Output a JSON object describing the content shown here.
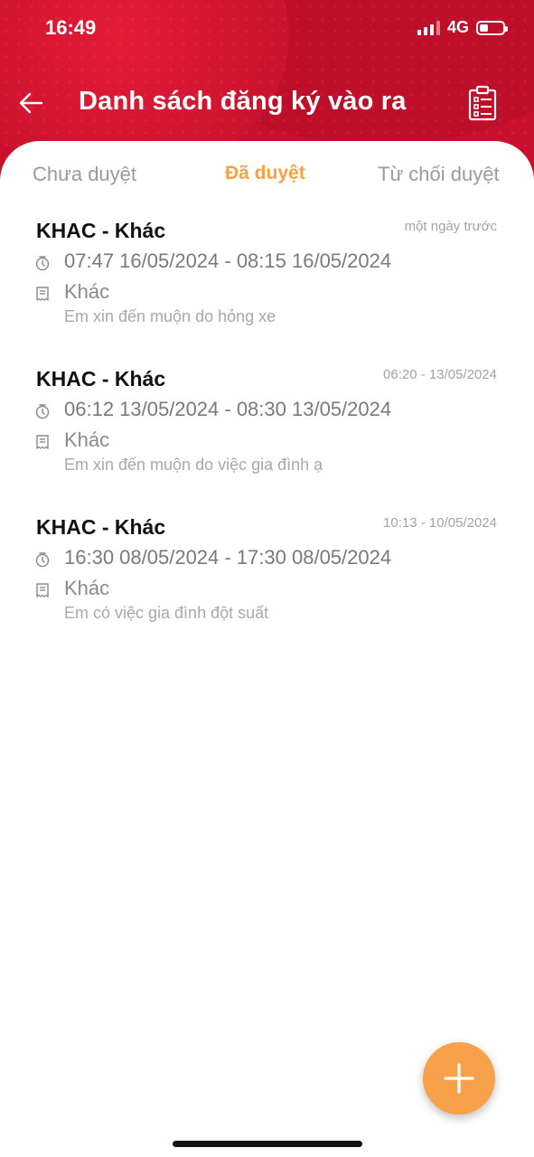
{
  "status_bar": {
    "time": "16:49",
    "network": "4G"
  },
  "header": {
    "title": "Danh sách đăng ký vào ra"
  },
  "tabs": [
    {
      "label": "Chưa duyệt",
      "active": false
    },
    {
      "label": "Đã duyệt",
      "active": true
    },
    {
      "label": "Từ chối duyệt",
      "active": false
    }
  ],
  "items": [
    {
      "title": "KHAC - Khác",
      "submitted": "một ngày trước",
      "range": "07:47 16/05/2024 - 08:15 16/05/2024",
      "type": "Khác",
      "reason": "Em xin đến muộn do hỏng xe"
    },
    {
      "title": "KHAC - Khác",
      "submitted": "06:20 - 13/05/2024",
      "range": "06:12 13/05/2024 - 08:30 13/05/2024",
      "type": "Khác",
      "reason": "Em xin đến muộn do việc gia đình ạ"
    },
    {
      "title": "KHAC - Khác",
      "submitted": "10:13 - 10/05/2024",
      "range": "16:30 08/05/2024 - 17:30 08/05/2024",
      "type": "Khác",
      "reason": "Em có việc gia đình đột suất"
    }
  ],
  "icons": {
    "back": "arrow-left-icon",
    "clipboard": "clipboard-list-icon",
    "clock": "clock-icon",
    "note": "receipt-icon",
    "add": "plus-icon"
  },
  "colors": {
    "header": "#c8102e",
    "active_tab": "#f6a242",
    "fab": "#f7a24a"
  }
}
